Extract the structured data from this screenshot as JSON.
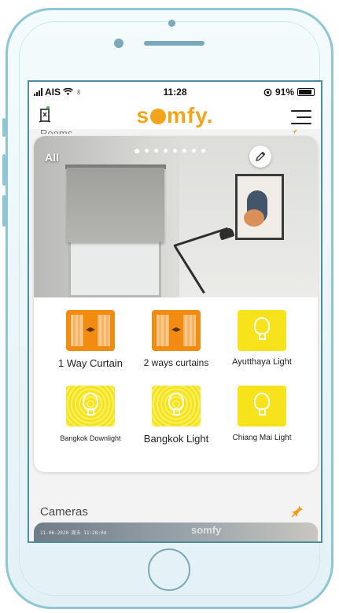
{
  "status_bar": {
    "carrier": "AIS",
    "time": "11:28",
    "battery": "91%",
    "battery_level": 0.91
  },
  "header": {
    "logo_parts": [
      "s",
      "mfy"
    ],
    "logo_dot": "."
  },
  "rooms": {
    "section_label_peek": "Rooms",
    "current_room": "All",
    "page_count": 8,
    "active_page": 1
  },
  "devices": [
    {
      "label": "1 Way Curtain",
      "type": "curtain",
      "icon": "curtain-icon"
    },
    {
      "label": "2 ways curtains",
      "type": "curtain",
      "icon": "curtain-icon"
    },
    {
      "label": "Ayutthaya Light",
      "type": "light",
      "icon": "light-bulb-icon"
    },
    {
      "label": "Bangkok Downlight",
      "type": "light-ringed",
      "icon": "downlight-icon"
    },
    {
      "label": "Bangkok Light",
      "type": "light-ringed",
      "icon": "light-bulb-icon"
    },
    {
      "label": "Chiang Mai Light",
      "type": "light",
      "icon": "light-bulb-icon"
    }
  ],
  "cameras": {
    "title": "Cameras",
    "preview_timestamp": "11-06-2020 周五 11:28:04",
    "preview_logo": "somfy"
  },
  "colors": {
    "brand": "#f2a51a",
    "curtain_tile": "#f28b12",
    "light_tile": "#f7e31b",
    "pin": "#f29a1a"
  }
}
